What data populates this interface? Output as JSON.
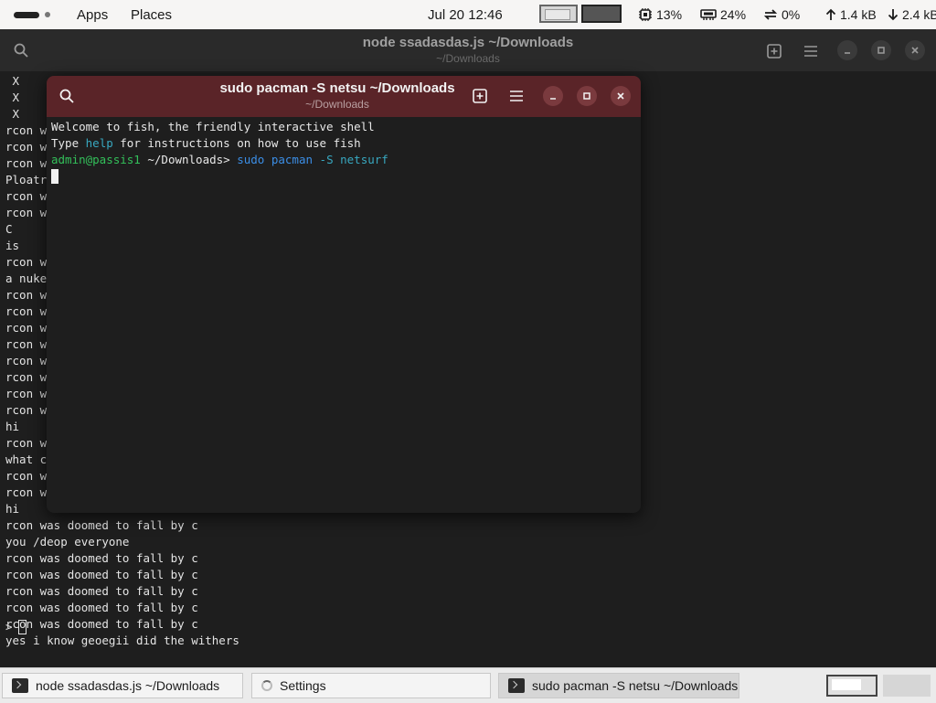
{
  "topbar": {
    "apps_label": "Apps",
    "places_label": "Places",
    "clock": "Jul 20  12:46",
    "cpu": "13%",
    "memory": "24%",
    "swap": "0%",
    "upload": "1.4 kB",
    "download": "2.4 kB",
    "icons": {
      "cpu": "cpu-chip-icon",
      "memory": "memory-icon",
      "swap": "swap-arrows-icon",
      "up": "arrow-up-icon",
      "down": "arrow-down-icon"
    }
  },
  "bg_window": {
    "title": "node ssadasdas.js ~/Downloads",
    "subtitle": "~/Downloads",
    "lines": [
      " X",
      " X",
      " X",
      "rcon w",
      "rcon w",
      "rcon w",
      "Ploatr",
      "rcon w",
      "rcon w",
      "C",
      "is",
      "rcon w",
      "a nuke",
      "rcon w",
      "rcon w",
      "rcon w",
      "rcon w",
      "rcon w",
      "rcon w",
      "rcon w",
      "rcon w",
      "hi",
      "rcon w",
      "what c",
      "rcon w",
      "rcon w",
      "hi",
      "rcon was doomed to fall by c",
      "you /deop everyone",
      "rcon was doomed to fall by c",
      "rcon was doomed to fall by c",
      "rcon was doomed to fall by c",
      "rcon was doomed to fall by c",
      "rcon was doomed to fall by c",
      "yes i know geoegii did the withers"
    ],
    "prompt": ">"
  },
  "fg_window": {
    "title": "sudo pacman -S netsu ~/Downloads",
    "subtitle": "~/Downloads",
    "welcome": "Welcome to fish, the friendly interactive shell",
    "type_prefix": "Type ",
    "help_word": "help",
    "type_suffix": " for instructions on how to use fish",
    "prompt_user": "admin@passis1",
    "prompt_dir": " ~/Downloads",
    "prompt_sym": "> ",
    "command_sudo": "sudo",
    "command_pacman": "pacman",
    "command_args": "-S netsurf",
    "header_color": "#5a2428"
  },
  "taskbar": {
    "items": [
      {
        "label": "node ssadasdas.js ~/Downloads",
        "icon": "terminal-icon"
      },
      {
        "label": "Settings",
        "icon": "loading-spinner-icon"
      },
      {
        "label": "sudo pacman -S netsu ~/Downloads",
        "icon": "terminal-icon"
      }
    ]
  }
}
